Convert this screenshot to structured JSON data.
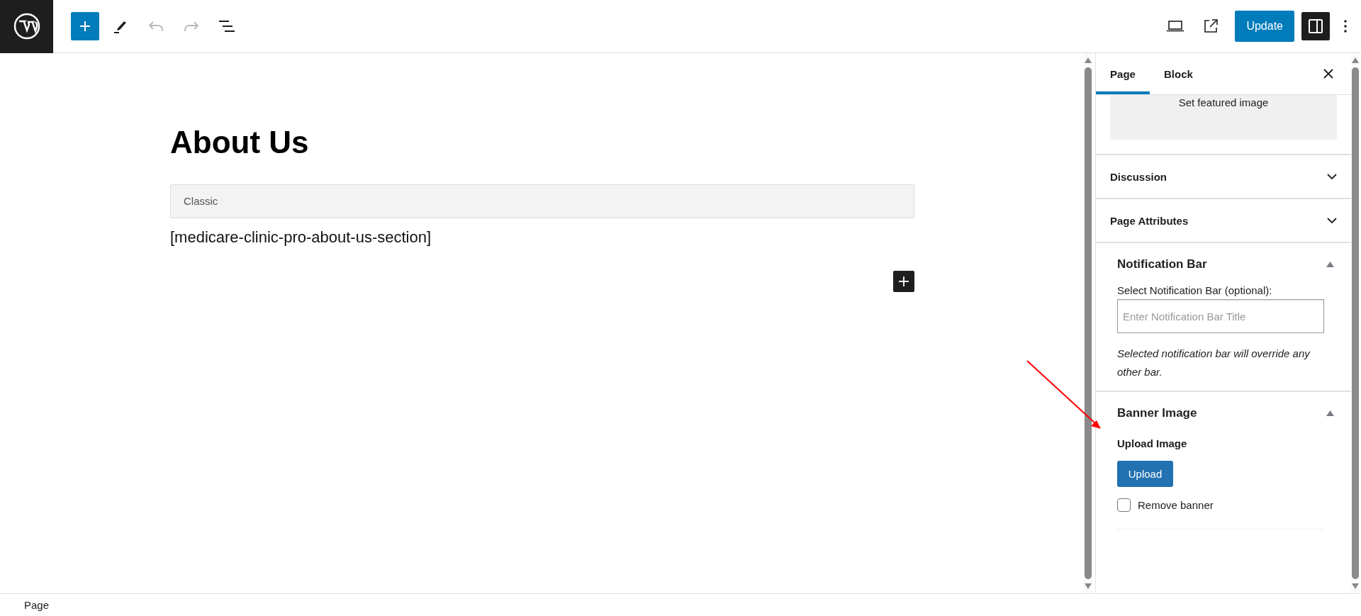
{
  "toolbar": {
    "left": [
      {
        "kind": "add",
        "disabled": false
      },
      {
        "kind": "pen",
        "disabled": false
      },
      {
        "kind": "undo",
        "disabled": true
      },
      {
        "kind": "redo",
        "disabled": true
      },
      {
        "kind": "outline",
        "disabled": false
      }
    ],
    "update_label": "Update",
    "settings_on": true
  },
  "editor": {
    "title": "About Us",
    "classic_label": "Classic",
    "shortcode": "[medicare-clinic-pro-about-us-section]"
  },
  "sidebar": {
    "tabs": [
      {
        "label": "Page",
        "selected": true
      },
      {
        "label": "Block",
        "selected": false
      }
    ],
    "featured_image": "Set featured image",
    "panels": [
      {
        "title": "Discussion",
        "expanded": false
      },
      {
        "title": "Page Attributes",
        "expanded": false
      }
    ],
    "notification": {
      "title": "Notification Bar",
      "expanded": true,
      "label": "Select Notification Bar (optional):",
      "placeholder": "Enter Notification Bar Title",
      "help": "Selected notification bar will override any other bar."
    },
    "banner": {
      "title": "Banner Image",
      "expanded": true,
      "upload_label": "Upload Image",
      "button": "Upload",
      "remove_label": "Remove banner",
      "remove_checked": false
    }
  },
  "status_bar": "Page"
}
